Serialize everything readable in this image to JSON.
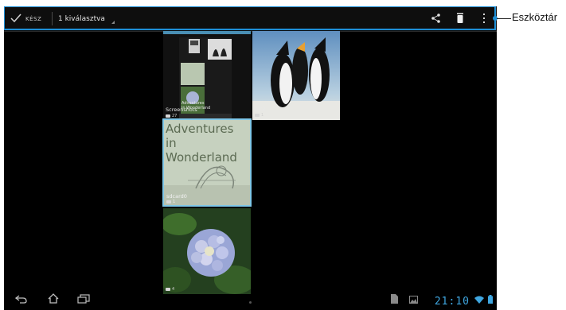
{
  "actionbar": {
    "done_label": "KÉSZ",
    "selection_label": "1 kiválasztva"
  },
  "callout": {
    "label": "Eszköztár"
  },
  "albums": [
    {
      "name": "Screenshots",
      "count": "27"
    },
    {
      "name": "pic2",
      "count": "1"
    },
    {
      "name": "sdcard0",
      "count": "1"
    },
    {
      "name": "",
      "count": "4"
    }
  ],
  "wonderland_text": {
    "line1": "Adventures",
    "line2": "in Wonderland",
    "mini1": "Adventures",
    "mini2": "in Wonderland"
  },
  "statusbar": {
    "time": "21:10"
  },
  "colors": {
    "accent": "#1e8fd6",
    "clock": "#3fa6e0",
    "selection_border": "#7fc7e8"
  }
}
